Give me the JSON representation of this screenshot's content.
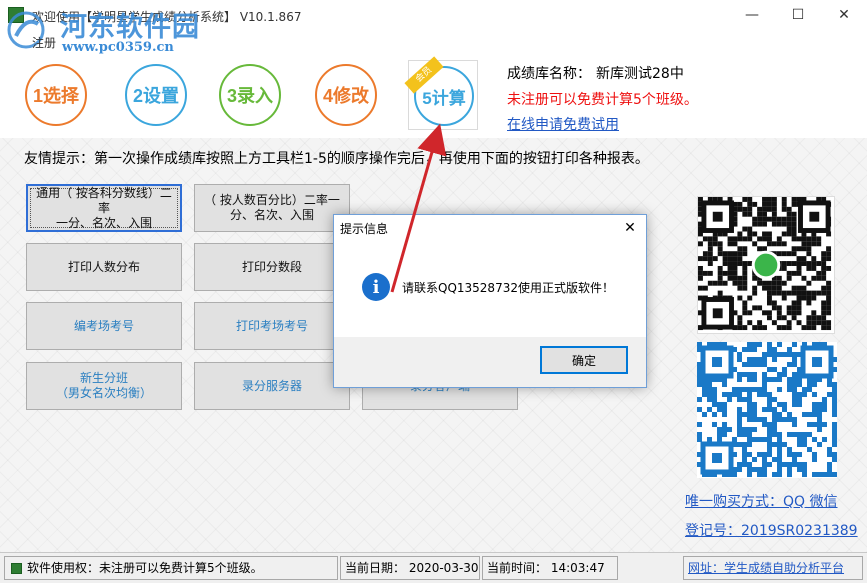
{
  "window": {
    "title": "欢迎使用【学明星学生成绩分析系统】 V10.1.867",
    "menu_register": "注册",
    "watermark_name": "河东软件园",
    "watermark_url": "www.pc0359.cn"
  },
  "toolbar": {
    "step1": "1选择",
    "step2": "2设置",
    "step3": "3录入",
    "step4": "4修改",
    "step5": "5计算",
    "member_ribbon": "会员"
  },
  "info": {
    "db_name_label": "成绩库名称：",
    "db_name_value": "新库测试28中",
    "unregistered_note": "未注册可以免费计算5个班级。",
    "trial_link": "在线申请免费试用"
  },
  "tip": "友情提示：第一次操作成绩库按照上方工具栏1-5的顺序操作完后，再使用下面的按钮打印各种报表。",
  "report_buttons": [
    {
      "label": "通用（ 按各科分数线）二率\n一分、名次、入围"
    },
    {
      "label": "（ 按人数百分比）二率一\n分、名次、入围"
    },
    {
      "label": "打印人数分布"
    },
    {
      "label": "打印分数段"
    },
    {
      "label": "编考场考号"
    },
    {
      "label": "打印考场考号"
    },
    {
      "label": "新生分班\n（男女名次均衡）"
    },
    {
      "label": "录分服务器"
    },
    {
      "label": "录分客户端"
    }
  ],
  "side": {
    "buy_link": "唯一购买方式：QQ 微信",
    "reg_no": "登记号：2019SR0231389"
  },
  "statusbar": {
    "usage": "软件使用权：未注册可以免费计算5个班级。",
    "date": "当前日期：  2020-03-30",
    "time": "当前时间：  14:03:47",
    "site": "网址：学生成绩自助分析平台"
  },
  "dialog": {
    "title": "提示信息",
    "message": "请联系QQ13528732使用正式版软件！",
    "ok_label": "确定"
  },
  "colors": {
    "orange": "#ec7a2c",
    "blue": "#3ba6dd",
    "green": "#67b93a",
    "warning_red": "#e11111",
    "link_blue": "#2259c4",
    "arrow_red": "#d0262b"
  },
  "icons": {
    "app": "app-icon",
    "dialog_info": "info-icon",
    "wechat_qr": "qr-code-icon",
    "qq_qr": "qr-code-icon"
  }
}
